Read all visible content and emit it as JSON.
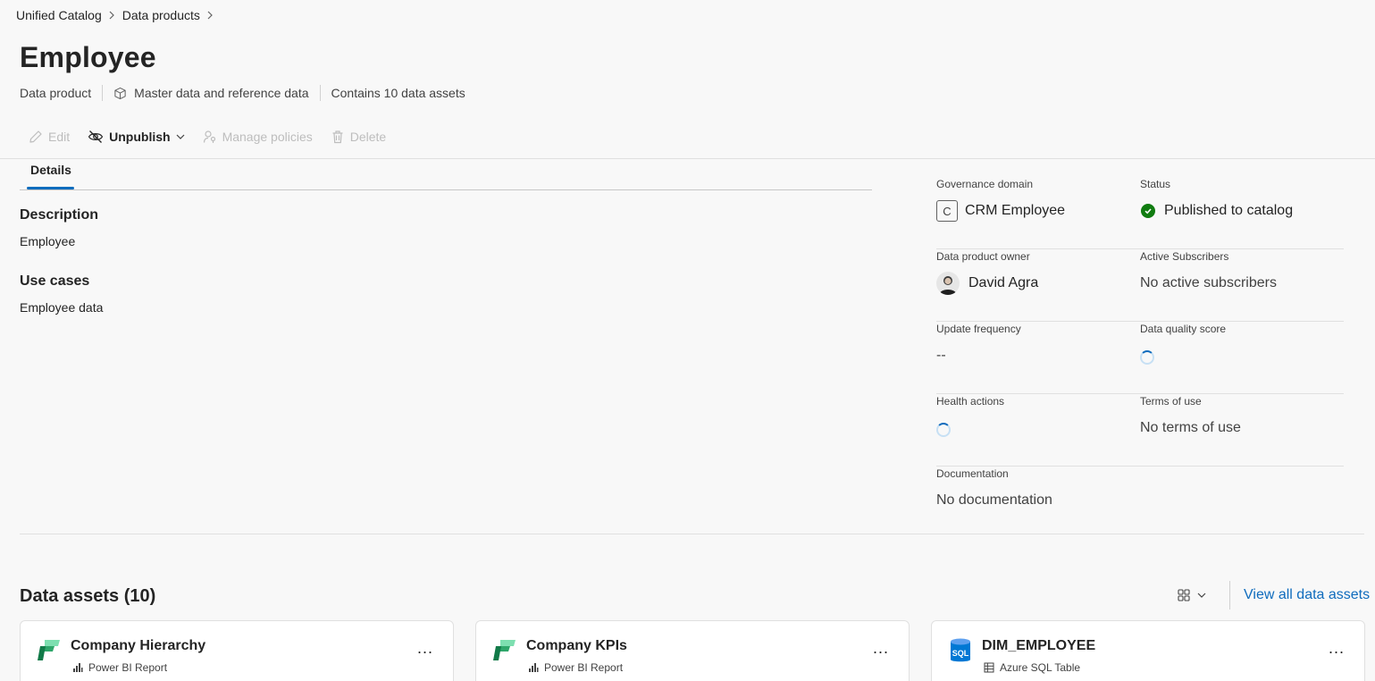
{
  "breadcrumb": {
    "items": [
      "Unified Catalog",
      "Data products"
    ]
  },
  "page": {
    "title": "Employee",
    "meta": {
      "type": "Data product",
      "category": "Master data and reference data",
      "asset_count": "Contains 10 data assets"
    }
  },
  "toolbar": {
    "edit": "Edit",
    "unpublish": "Unpublish",
    "manage_policies": "Manage policies",
    "delete": "Delete"
  },
  "tabs": {
    "details": "Details"
  },
  "details": {
    "description_label": "Description",
    "description_value": "Employee",
    "use_cases_label": "Use cases",
    "use_cases_value": "Employee data"
  },
  "properties": {
    "governance_domain_label": "Governance domain",
    "governance_domain_initial": "C",
    "governance_domain_value": "CRM Employee",
    "status_label": "Status",
    "status_value": "Published to catalog",
    "owner_label": "Data product owner",
    "owner_value": "David Agra",
    "subscribers_label": "Active Subscribers",
    "subscribers_value": "No active subscribers",
    "update_frequency_label": "Update frequency",
    "update_frequency_value": "--",
    "quality_label": "Data quality score",
    "health_label": "Health actions",
    "terms_label": "Terms of use",
    "terms_value": "No terms of use",
    "documentation_label": "Documentation",
    "documentation_value": "No documentation"
  },
  "assets": {
    "heading": "Data assets (10)",
    "view_all": "View all data assets",
    "cards": [
      {
        "name": "Company Hierarchy",
        "type": "Power BI Report",
        "icon": "powerbi-icon"
      },
      {
        "name": "Company KPIs",
        "type": "Power BI Report",
        "icon": "powerbi-icon"
      },
      {
        "name": "DIM_EMPLOYEE",
        "type": "Azure SQL Table",
        "icon": "sql-icon"
      }
    ],
    "more_label": "..."
  },
  "colors": {
    "accent": "#0f6cbd",
    "status_ok": "#107c10",
    "fabric_green": "#2ea66a"
  }
}
